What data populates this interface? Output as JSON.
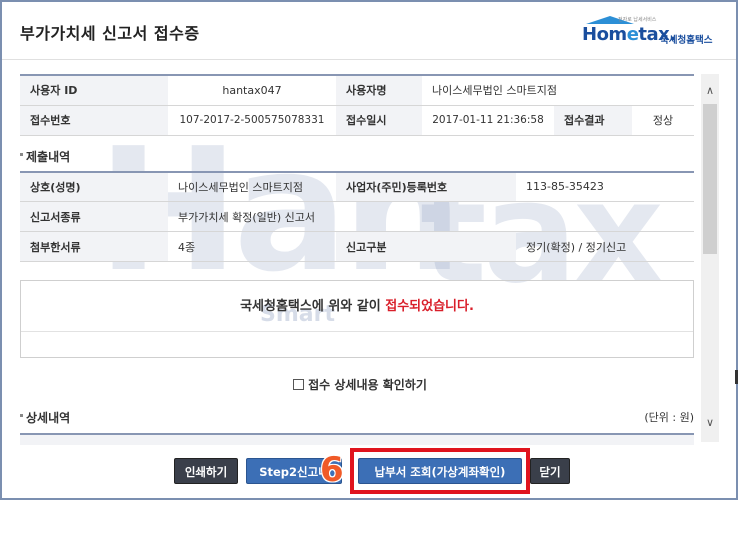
{
  "window": {
    "title": "부가가치세 신고서 접수증"
  },
  "logo": {
    "brand_main": "Hom",
    "brand_e": "e",
    "brand_tail": "tax.",
    "brand_sub": "국세청홈택스",
    "tagline": "전자로 납세서비스"
  },
  "user_info": {
    "rows": [
      {
        "label1": "사용자 ID",
        "value1": "hantax047",
        "label2": "사용자명",
        "value2": "나이스세무법인 스마트지점"
      },
      {
        "label1": "접수번호",
        "value1": "107-2017-2-500575078331",
        "label2": "접수일시",
        "value2": "2017-01-11 21:36:58",
        "label3": "접수결과",
        "value3": "정상"
      }
    ]
  },
  "submission": {
    "section_title": "제출내역",
    "rows": [
      {
        "label1": "상호(성명)",
        "value1": "나이스세무법인 스마트지점",
        "label2": "사업자(주민)등록번호",
        "value2": "113-85-35423"
      },
      {
        "label1": "신고서종류",
        "value1": "부가가치세 확정(일반) 신고서"
      },
      {
        "label1": "첨부한서류",
        "value1": "4종",
        "label2": "신고구분",
        "value2": "정기(확정) / 정기신고"
      }
    ]
  },
  "notice": {
    "prefix": "국세청홈택스에 위와 같이 ",
    "highlight": "접수되었습니다."
  },
  "confirm_checkbox": {
    "label": "접수 상세내용 확인하기"
  },
  "detail": {
    "section_title": "상세내역",
    "unit": "(단위 : 원)"
  },
  "watermark": {
    "big1": "Han",
    "big2": "tax",
    "small": "Smart"
  },
  "buttons": {
    "print": "인쇄하기",
    "step2": "Step2신고내",
    "payment": "납부서 조회(가상계좌확인)",
    "close": "닫기"
  },
  "annotation": {
    "step_number": "6"
  },
  "colors": {
    "highlight_red": "#e0141e",
    "accent_blue": "#3c6fb6",
    "notice_red": "#d91f2a",
    "step_orange": "#f05a28"
  }
}
